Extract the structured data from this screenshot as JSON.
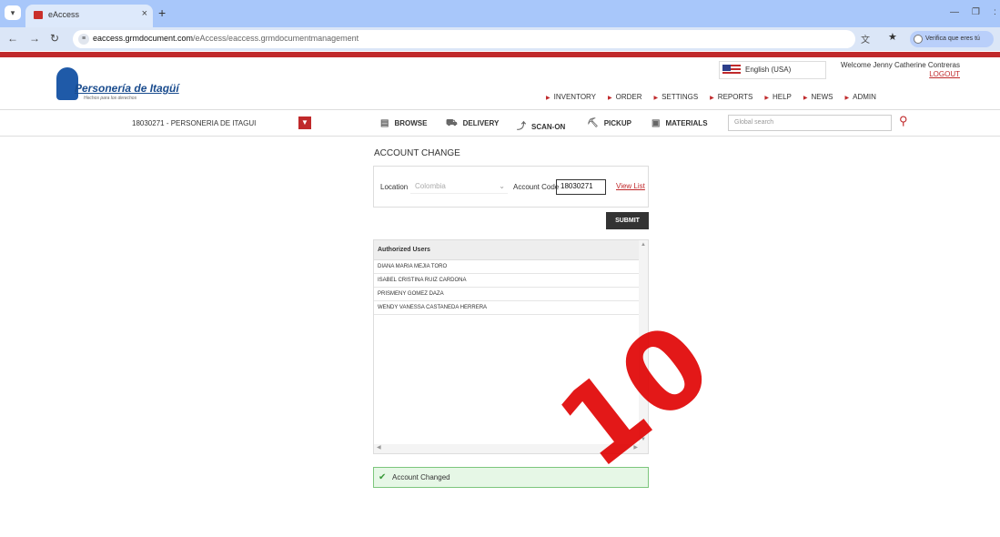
{
  "browser": {
    "tab_title": "eAccess",
    "url_host": "eaccess.grmdocument.com",
    "url_path": "/eAccess/eaccess.grmdocumentmanagement",
    "profile_label": "Verifica que eres tú"
  },
  "brand": {
    "name": "Personería de Itagüí",
    "tagline": "Hechos para los derechos"
  },
  "header": {
    "language": "English (USA)",
    "welcome": "Welcome Jenny Catherine Contreras",
    "logout": "LOGOUT",
    "menu": [
      "INVENTORY",
      "ORDER",
      "SETTINGS",
      "REPORTS",
      "HELP",
      "NEWS",
      "ADMIN"
    ]
  },
  "toolbar": {
    "account": "18030271 - PERSONERIA DE ITAGUI",
    "items": [
      "BROWSE",
      "DELIVERY",
      "SCAN-ON",
      "PICKUP",
      "MATERIALS"
    ],
    "search_placeholder": "Global search"
  },
  "main": {
    "heading": "ACCOUNT CHANGE",
    "location_label": "Location",
    "location_value": "Colombia",
    "account_code_label": "Account Code",
    "account_code_value": "18030271",
    "view_list": "View List",
    "submit": "SUBMIT",
    "users_header": "Authorized Users",
    "users": [
      "DIANA MARIA MEJIA TORO",
      "ISABEL CRISTINA RUIZ CARDONA",
      "PRISMENY GOMEZ DAZA",
      "WENDY VANESSA CASTANEDA HERRERA"
    ],
    "success": "Account Changed"
  },
  "watermark": "10",
  "colors": {
    "brand_red": "#c0292b",
    "tab_bar": "#a8c7fa"
  }
}
